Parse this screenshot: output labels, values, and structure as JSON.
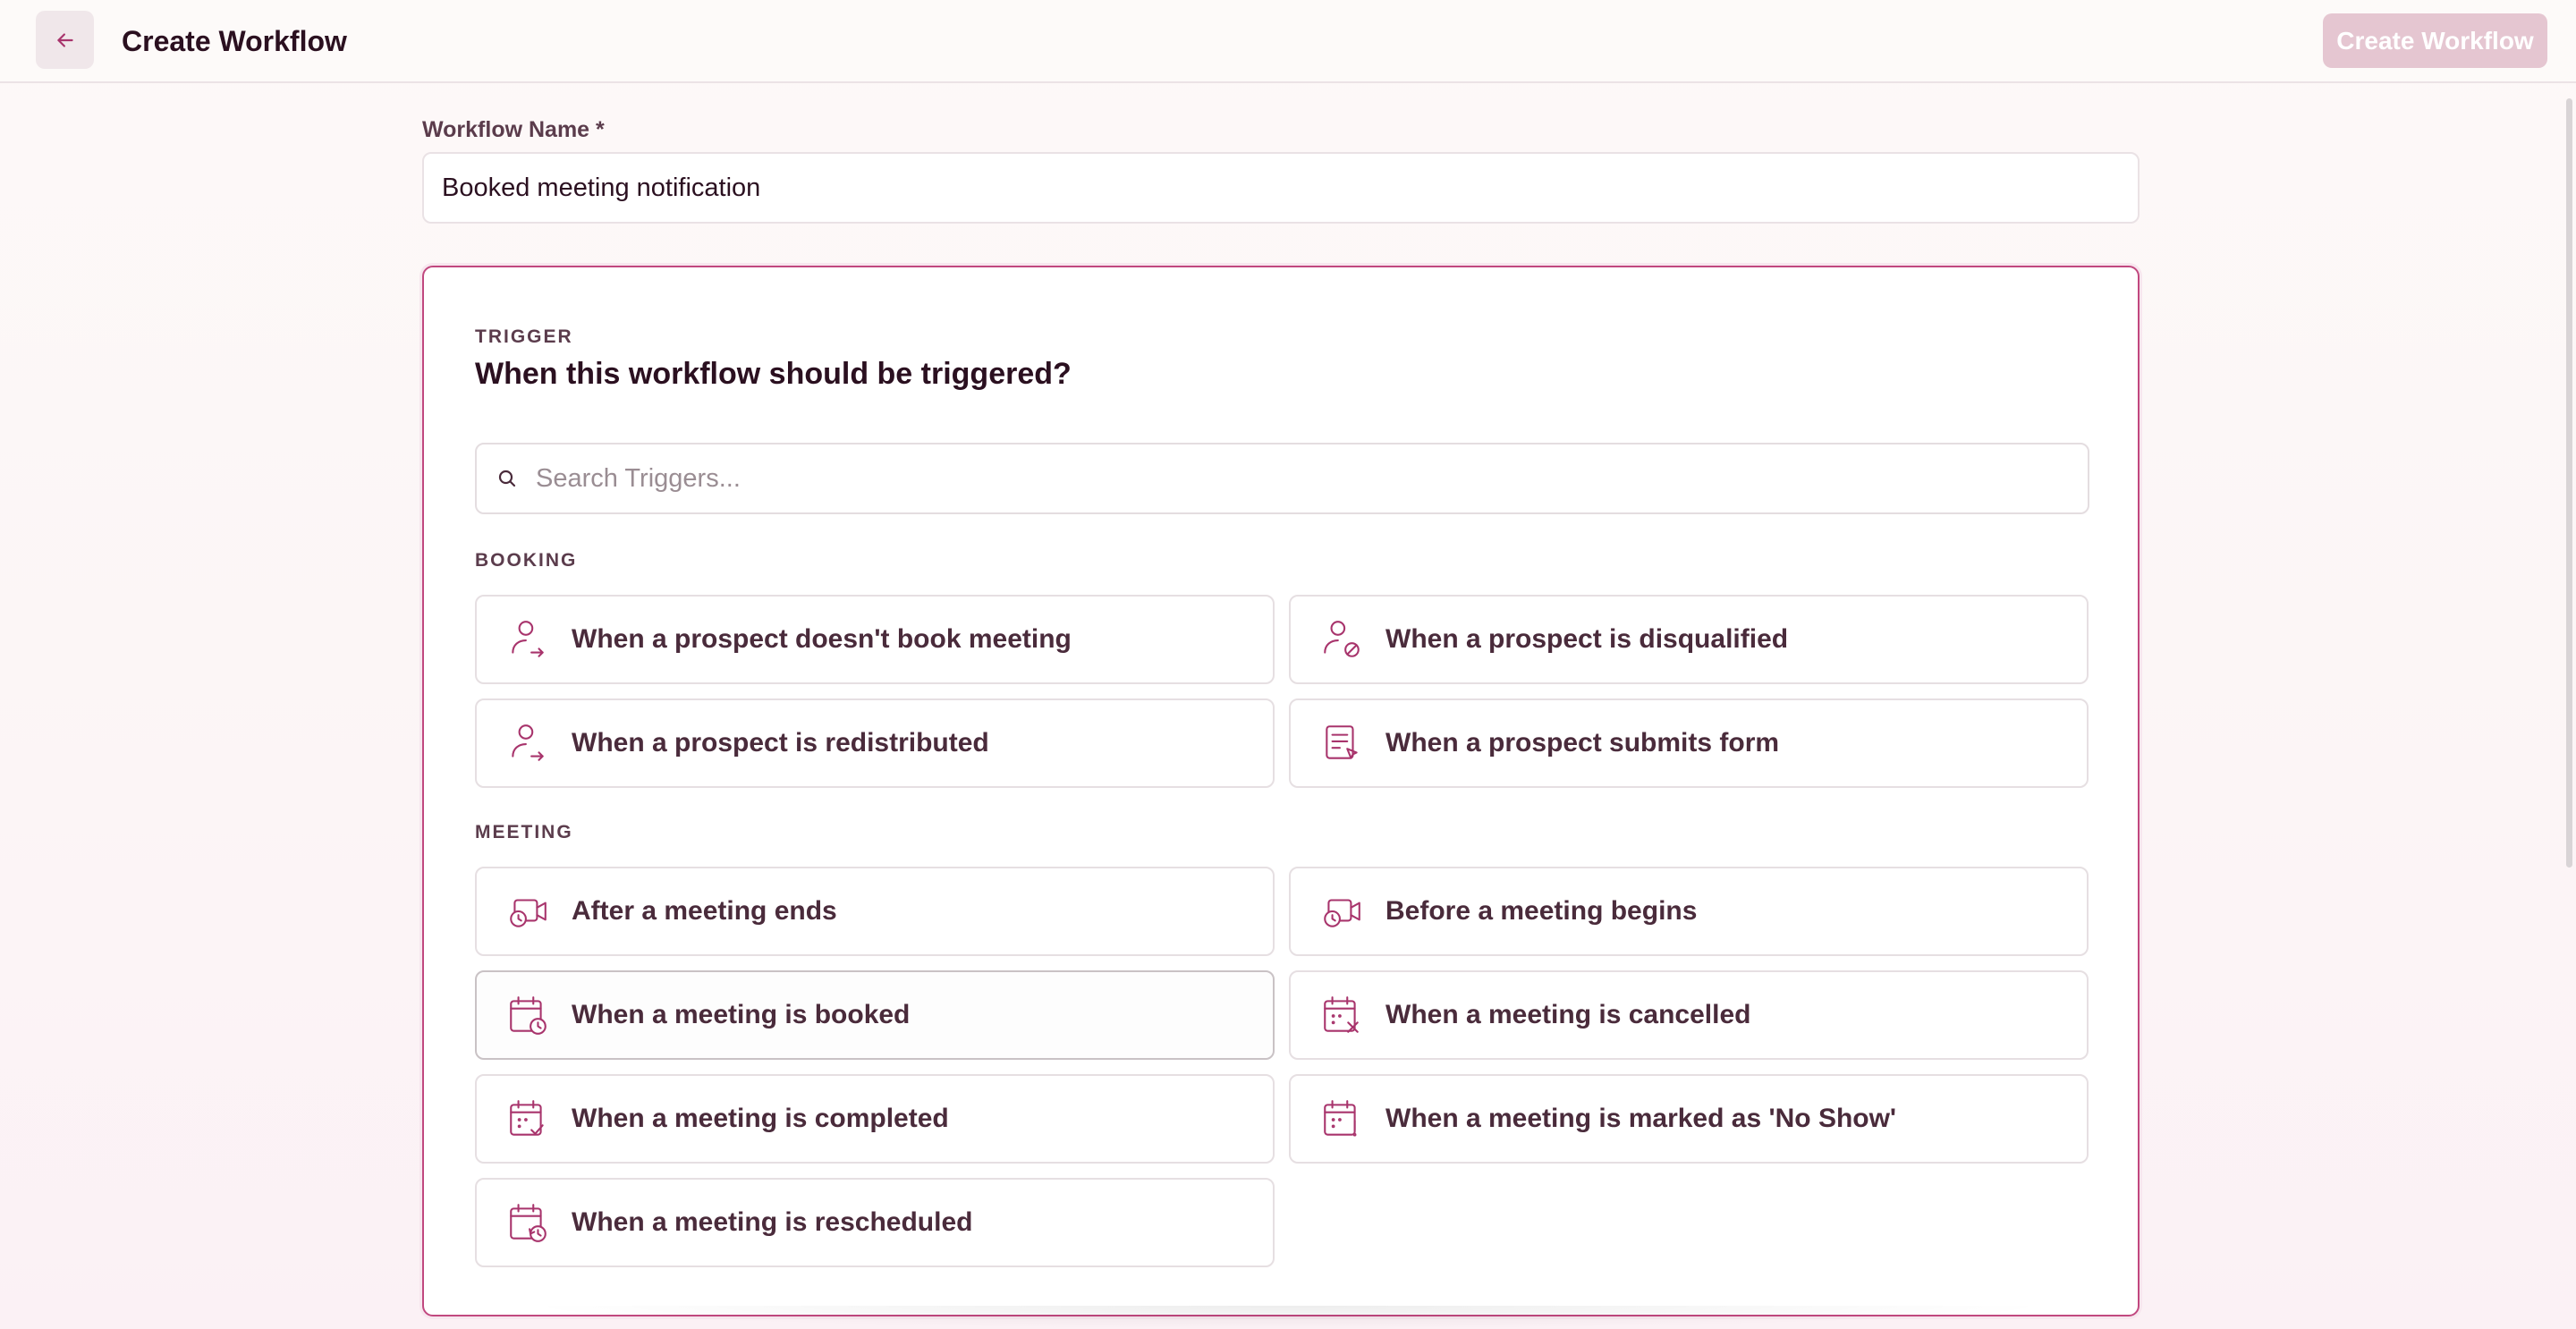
{
  "header": {
    "title": "Create Workflow",
    "create_button_label": "Create Workflow"
  },
  "workflow_name": {
    "label": "Workflow Name *",
    "value": "Booked meeting notification"
  },
  "trigger": {
    "eyebrow": "TRIGGER",
    "title": "When this workflow should be triggered?",
    "search_placeholder": "Search Triggers...",
    "sections": [
      {
        "label": "BOOKING",
        "items": [
          {
            "label": "When a prospect doesn't book meeting",
            "icon": "user-redirect-icon"
          },
          {
            "label": "When a prospect is disqualified",
            "icon": "user-blocked-icon"
          },
          {
            "label": "When a prospect is redistributed",
            "icon": "user-redirect-icon"
          },
          {
            "label": "When a prospect submits form",
            "icon": "form-submit-icon"
          }
        ]
      },
      {
        "label": "MEETING",
        "items": [
          {
            "label": "After a meeting ends",
            "icon": "video-clock-icon"
          },
          {
            "label": "Before a meeting begins",
            "icon": "video-clock-icon"
          },
          {
            "label": "When a meeting is booked",
            "icon": "calendar-clock-icon",
            "selected": true
          },
          {
            "label": "When a meeting is cancelled",
            "icon": "calendar-x-icon"
          },
          {
            "label": "When a meeting is completed",
            "icon": "calendar-check-icon"
          },
          {
            "label": "When a meeting is marked as 'No Show'",
            "icon": "calendar-alert-icon"
          },
          {
            "label": "When a meeting is rescheduled",
            "icon": "calendar-history-icon"
          }
        ]
      }
    ]
  },
  "colors": {
    "accent": "#c1487f",
    "icon": "#a8346c",
    "primary_disabled": "#e5c6d1",
    "text_dark": "#2b1020"
  }
}
